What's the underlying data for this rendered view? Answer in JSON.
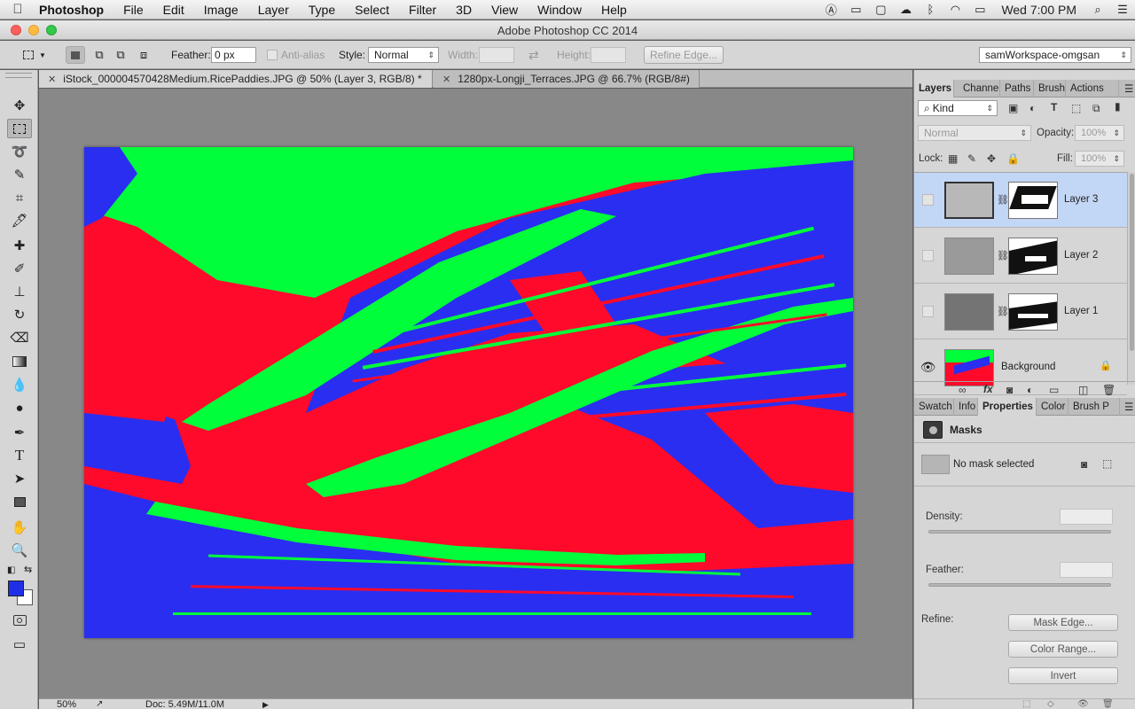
{
  "menubar": {
    "app": "Photoshop",
    "items": [
      "File",
      "Edit",
      "Image",
      "Layer",
      "Type",
      "Select",
      "Filter",
      "3D",
      "View",
      "Window",
      "Help"
    ],
    "clock": "Wed 7:00 PM",
    "status_icons": [
      "adobe-icon",
      "airplay-icon",
      "window-icon",
      "cloud-icon",
      "bluetooth-icon",
      "wifi-icon",
      "battery-icon"
    ]
  },
  "window": {
    "title": "Adobe Photoshop CC 2014"
  },
  "options": {
    "feather_label": "Feather:",
    "feather_value": "0 px",
    "antialias_label": "Anti-alias",
    "style_label": "Style:",
    "style_value": "Normal",
    "width_label": "Width:",
    "height_label": "Height:",
    "refine_edge_label": "Refine Edge...",
    "workspace": "samWorkspace-omgsan"
  },
  "tabs": [
    {
      "label": "iStock_000004570428Medium.RicePaddies.JPG @ 50% (Layer 3, RGB/8) *",
      "active": true
    },
    {
      "label": "1280px-Longji_Terraces.JPG @ 66.7% (RGB/8#)",
      "active": false
    }
  ],
  "status": {
    "zoom": "50%",
    "doc": "Doc: 5.49M/11.0M"
  },
  "colors": {
    "foreground": "#1f2fe8",
    "background": "#ffffff",
    "image_red": "#ff0a2a",
    "image_green": "#00ff3a",
    "image_blue": "#2a2ef0",
    "selection": "#c2d6f5"
  },
  "layers_panel": {
    "tabs": [
      "Layers",
      "Channel",
      "Paths",
      "Brush",
      "Actions"
    ],
    "kind_label": "Kind",
    "blend_mode": "Normal",
    "opacity_label": "Opacity:",
    "opacity_value": "100%",
    "lock_label": "Lock:",
    "fill_label": "Fill:",
    "fill_value": "100%",
    "layers": [
      {
        "name": "Layer 3",
        "selected": true
      },
      {
        "name": "Layer 2",
        "selected": false
      },
      {
        "name": "Layer 1",
        "selected": false
      },
      {
        "name": "Background",
        "selected": false
      }
    ]
  },
  "properties_panel": {
    "tabs": [
      "Swatch",
      "Info",
      "Properties",
      "Color",
      "Brush P"
    ],
    "section": "Masks",
    "no_mask": "No mask selected",
    "density_label": "Density:",
    "feather_label": "Feather:",
    "refine_label": "Refine:",
    "mask_edge_label": "Mask Edge...",
    "color_range_label": "Color Range...",
    "invert_label": "Invert"
  }
}
